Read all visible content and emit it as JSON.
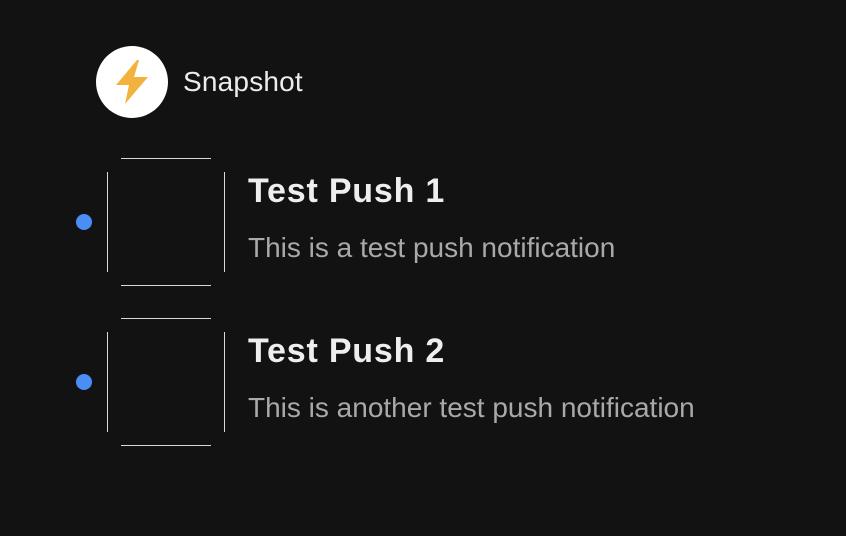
{
  "app": {
    "name": "Snapshot",
    "icon": "lightning-bolt-icon",
    "icon_color": "#F3B23E",
    "icon_background": "#FFFFFF"
  },
  "notifications": [
    {
      "title": "Test Push 1",
      "body": "This is a test push notification",
      "unread": true,
      "thumbnail": "empty-thumbnail"
    },
    {
      "title": "Test Push 2",
      "body": "This is another test push notification",
      "unread": true,
      "thumbnail": "empty-thumbnail"
    }
  ],
  "colors": {
    "background": "#121212",
    "unread_dot": "#4A8EF5",
    "title_text": "#EEEEEE",
    "body_text": "#A9A9A9"
  }
}
